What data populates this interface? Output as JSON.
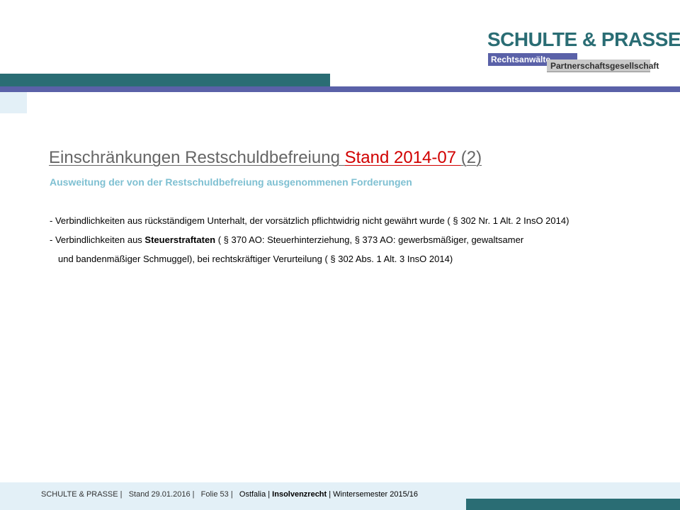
{
  "logo": {
    "title": "SCHULTE & PRASSE",
    "sub1": "Rechtsanwälte",
    "sub2": "Partnerschaftsgesellschaft"
  },
  "slide": {
    "title_main": "Einschränkungen Restschuldbefreiung ",
    "title_stand": "Stand 2014-07 ",
    "title_num": "(2)",
    "subtitle": "Ausweitung der von der Restschuldbefreiung ausgenommenen Forderungen",
    "line1": "- Verbindlichkeiten aus rückständigem Unterhalt, der vorsätzlich pflichtwidrig nicht gewährt wurde ( §  302 Nr. 1 Alt. 2 InsO 2014)",
    "line2_pre": "- Verbindlichkeiten aus ",
    "line2_bold": "Steuerstraftaten",
    "line2_post": "  ( § 370 AO: Steuerhinterziehung,  §  373 AO: gewerbsmäßiger,  gewaltsamer",
    "line3": "und bandenmäßiger Schmuggel), bei rechtskräftiger Verurteilung ( § 302 Abs. 1 Alt. 3 InsO 2014)"
  },
  "footer": {
    "firm": "SCHULTE & PRASSE  |",
    "stand": "Stand 29.01.2016  |",
    "folie": "Folie  53  |",
    "ostfalia": "Ostfalia |",
    "course": "Insolvenzrecht",
    "semester": "| Wintersemester 2015/16"
  },
  "colors": {
    "teal": "#2a6d74",
    "blue": "#5a61a8",
    "red": "#d10000",
    "light_blue": "#e3f0f7",
    "subtitle": "#7fc0d2"
  }
}
